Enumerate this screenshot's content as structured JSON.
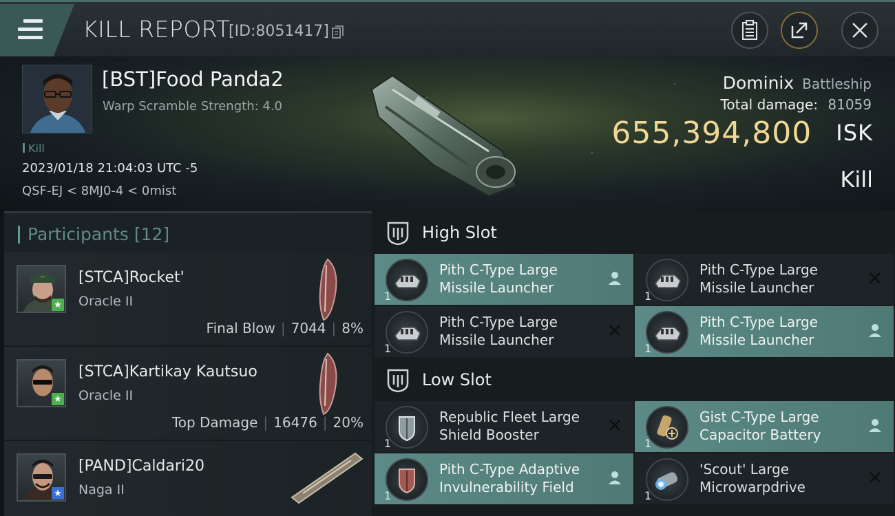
{
  "header": {
    "title": "KILL REPORT",
    "report_id": "[ID:8051417]"
  },
  "victim": {
    "name": "[BST]Food Panda2",
    "warp_scramble": "Warp Scramble Strength: 4.0",
    "kill_tag": "Kill",
    "datetime": "2023/01/18 21:04:03 UTC -5",
    "location": "QSF-EJ < 8MJ0-4 < 0mist",
    "ship_name": "Dominix",
    "ship_class": "Battleship",
    "total_damage_label": "Total damage:",
    "total_damage": "81059",
    "isk_value": "655,394,800",
    "isk_unit": "ISK",
    "result": "Kill"
  },
  "participants": {
    "title": "Participants",
    "count": "[12]",
    "items": [
      {
        "name": "[STCA]Rocket'",
        "ship": "Oracle II",
        "role": "Final Blow",
        "damage": "7044",
        "percent": "8%",
        "badge_color": "#4caf50"
      },
      {
        "name": "[STCA]Kartikay Kautsuo",
        "ship": "Oracle II",
        "role": "Top Damage",
        "damage": "16476",
        "percent": "20%",
        "badge_color": "#4caf50"
      },
      {
        "name": "[PAND]Caldari20",
        "ship": "Naga II",
        "role": "",
        "damage": "",
        "percent": "",
        "badge_color": "#3b6fd1"
      }
    ]
  },
  "slots": {
    "high": {
      "title": "High Slot",
      "modules": [
        {
          "name": "Pith C-Type Large Missile Launcher",
          "qty": "1",
          "status": "pilot-icon"
        },
        {
          "name": "Pith C-Type Large Missile Launcher",
          "qty": "1",
          "status": "close-icon"
        },
        {
          "name": "Pith C-Type Large Missile Launcher",
          "qty": "1",
          "status": "close-icon"
        },
        {
          "name": "Pith C-Type Large Missile Launcher",
          "qty": "1",
          "status": "pilot-icon"
        }
      ]
    },
    "low": {
      "title": "Low Slot",
      "modules": [
        {
          "name": "Republic Fleet Large Shield Booster",
          "qty": "1",
          "status": "close-icon"
        },
        {
          "name": "Gist C-Type Large Capacitor Battery",
          "qty": "1",
          "status": "pilot-icon"
        },
        {
          "name": "Pith C-Type Adaptive Invulnerability Field",
          "qty": "1",
          "status": "pilot-icon"
        },
        {
          "name": "'Scout' Large Microwarpdrive",
          "qty": "1",
          "status": "close-icon"
        }
      ]
    }
  },
  "icons": {
    "menu": "hamburger-menu-icon",
    "copy": "copy-icon",
    "clipboard": "clipboard-icon",
    "share": "share-icon",
    "close": "close-icon",
    "slot": "slot-rack-icon"
  }
}
